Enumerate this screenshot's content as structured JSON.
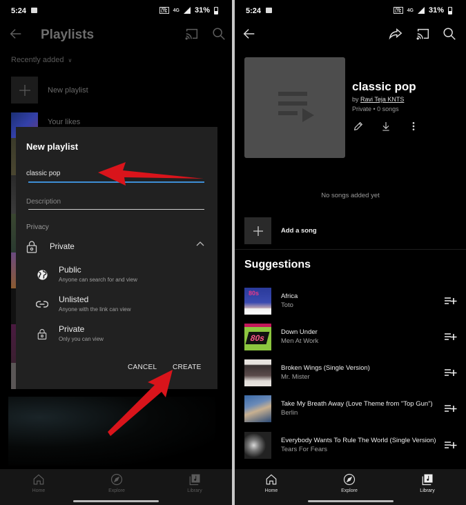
{
  "status_bar": {
    "time": "5:24",
    "battery": "31%",
    "network": "4G"
  },
  "left": {
    "header": {
      "title": "Playlists",
      "back_icon": "arrow-left-icon",
      "cast_icon": "cast-icon",
      "search_icon": "search-icon"
    },
    "sort_label": "Recently added",
    "list": [
      {
        "label": "New playlist"
      },
      {
        "label": "Your likes"
      }
    ],
    "dialog": {
      "title": "New playlist",
      "name_value": "classic pop",
      "description_placeholder": "Description",
      "privacy_label": "Privacy",
      "privacy_selected": "Private",
      "options": [
        {
          "title": "Public",
          "subtitle": "Anyone can search for and view",
          "icon": "globe-icon"
        },
        {
          "title": "Unlisted",
          "subtitle": "Anyone with the link can view",
          "icon": "link-icon"
        },
        {
          "title": "Private",
          "subtitle": "Only you can view",
          "icon": "lock-icon"
        }
      ],
      "cancel_label": "CANCEL",
      "create_label": "CREATE"
    },
    "nav": [
      {
        "label": "Home"
      },
      {
        "label": "Explore"
      },
      {
        "label": "Library"
      }
    ]
  },
  "right": {
    "playlist": {
      "title": "classic pop",
      "by_prefix": "by",
      "author": "Ravi Teja KNTS",
      "meta": "Private • 0 songs"
    },
    "empty_text": "No songs added yet",
    "add_song_label": "Add a song",
    "suggestions_title": "Suggestions",
    "suggestions": [
      {
        "title": "Africa",
        "artist": "Toto"
      },
      {
        "title": "Down Under",
        "artist": "Men At Work"
      },
      {
        "title": "Broken Wings (Single Version)",
        "artist": "Mr. Mister"
      },
      {
        "title": "Take My Breath Away (Love Theme from \"Top Gun\")",
        "artist": "Berlin"
      },
      {
        "title": "Everybody Wants To Rule The World (Single Version)",
        "artist": "Tears For Fears"
      }
    ],
    "nav": [
      {
        "label": "Home"
      },
      {
        "label": "Explore"
      },
      {
        "label": "Library"
      }
    ]
  },
  "colors": {
    "accent": "#3ea6ff",
    "annotation_arrow": "#d9141b",
    "dialog_bg": "#212121"
  }
}
